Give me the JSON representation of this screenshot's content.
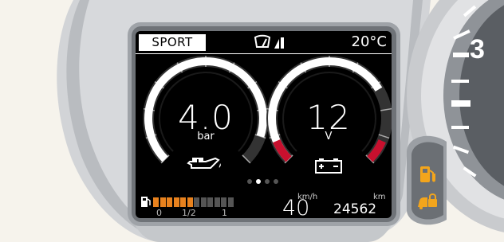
{
  "top_bar": {
    "drive_mode": "SPORT",
    "wiper_icon": "wiper-icon",
    "signal_icon": "signal-bars-icon",
    "temperature": "20°C"
  },
  "gauges": {
    "left": {
      "value": "4.0",
      "unit": "bar",
      "icon": "oil-can-icon",
      "fill": 0.9
    },
    "right": {
      "value": "12",
      "unit": "V",
      "icon": "battery-icon",
      "fill": 0.72
    }
  },
  "pager": {
    "count": 4,
    "active": 1
  },
  "fuel": {
    "icon": "fuel-pump-icon",
    "scale_labels": [
      "0",
      "1/2",
      "1"
    ],
    "level": 0.5,
    "segments_total": 12
  },
  "speed": {
    "unit": "km/h",
    "value": "40"
  },
  "odometer": {
    "unit": "km",
    "value": "24562"
  },
  "cluster": {
    "speedometer_digit": "3"
  },
  "warning_icons": [
    "fuel-warning-icon",
    "cruise-lock-icon"
  ],
  "colors": {
    "accent_orange": "#e8821e",
    "danger_red": "#c8102e",
    "panel_bg": "#000000"
  }
}
